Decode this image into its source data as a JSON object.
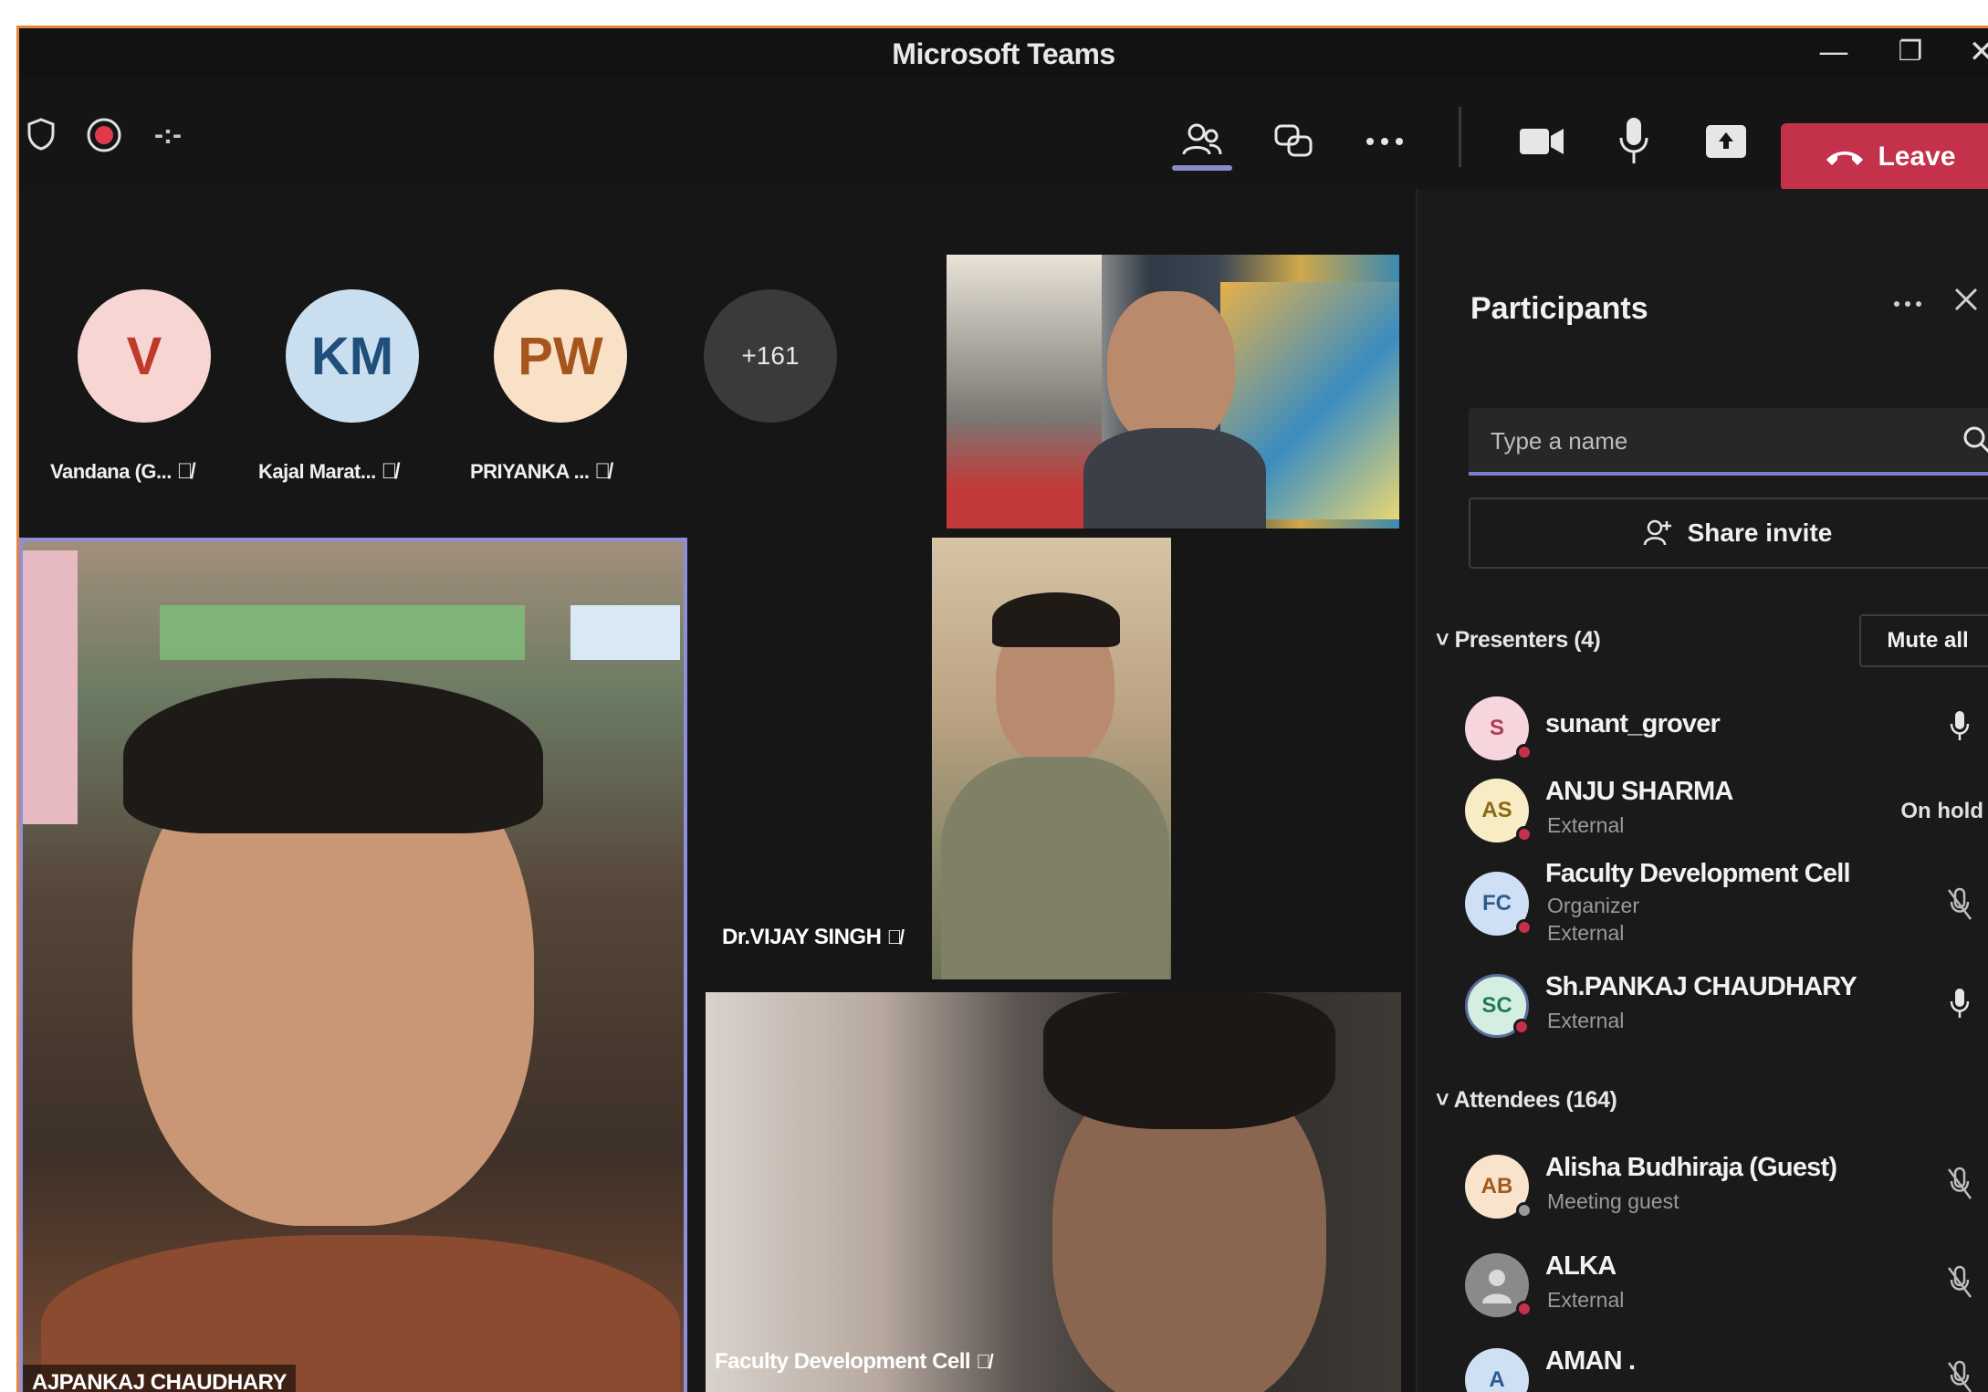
{
  "window": {
    "title": "Microsoft Teams",
    "minimize": "—",
    "maximize": "❐",
    "close": "✕"
  },
  "toolbar": {
    "timer": "-:-",
    "leave_label": "Leave"
  },
  "stage": {
    "avatars": [
      {
        "initials": "V",
        "label": "Vandana (G...",
        "bg": "#f7d5d2",
        "fg": "#c0392b"
      },
      {
        "initials": "KM",
        "label": "Kajal Marat...",
        "bg": "#c9dff0",
        "fg": "#1f4f7a"
      },
      {
        "initials": "PW",
        "label": "PRIYANKA ...",
        "bg": "#f9e1c8",
        "fg": "#a5561e"
      }
    ],
    "overflow_count": "+161",
    "tiles": [
      {
        "name": "AJPANKAJ CHAUDHARY"
      },
      {
        "name": "Dr.VIJAY SINGH"
      },
      {
        "name": "Faculty Development Cell"
      }
    ]
  },
  "panel": {
    "title": "Participants",
    "search_placeholder": "Type a name",
    "share_invite": "Share invite",
    "presenters_header": "Presenters (4)",
    "mute_all": "Mute all",
    "presenters": [
      {
        "initials": "S",
        "name": "sunant_grover",
        "sub1": "",
        "sub2": "",
        "status": "",
        "icon": "mic-icon",
        "bg": "#f6d6dc",
        "fg": "#b03a55"
      },
      {
        "initials": "AS",
        "name": "ANJU SHARMA",
        "sub1": "External",
        "sub2": "",
        "status": "On hold",
        "icon": "",
        "bg": "#f7ecc4",
        "fg": "#8a6a12"
      },
      {
        "initials": "FC",
        "name": "Faculty Development Cell",
        "sub1": "Organizer",
        "sub2": "External",
        "status": "",
        "icon": "mic-off-icon",
        "bg": "#cfe0f4",
        "fg": "#2a5b93"
      },
      {
        "initials": "SC",
        "name": "Sh.PANKAJ CHAUDHARY",
        "sub1": "External",
        "sub2": "",
        "status": "",
        "icon": "mic-icon",
        "bg": "#d4efe2",
        "fg": "#237a52"
      }
    ],
    "attendees_header": "Attendees (164)",
    "attendees": [
      {
        "initials": "AB",
        "name": "Alisha Budhiraja (Guest)",
        "sub1": "Meeting guest",
        "icon": "mic-off-icon",
        "bg": "#f9e3cc",
        "fg": "#a25a1c"
      },
      {
        "initials": "",
        "name": "ALKA",
        "sub1": "External",
        "icon": "mic-off-icon",
        "bg": "#8a8a8a",
        "fg": "#ffffff"
      },
      {
        "initials": "A",
        "name": "AMAN .",
        "sub1": "",
        "icon": "mic-off-icon",
        "bg": "#cfe0f4",
        "fg": "#2a5b93"
      }
    ]
  },
  "colors": {
    "accent": "#7b7fd0",
    "leave": "#c4314b",
    "frame": "#e8853a"
  }
}
